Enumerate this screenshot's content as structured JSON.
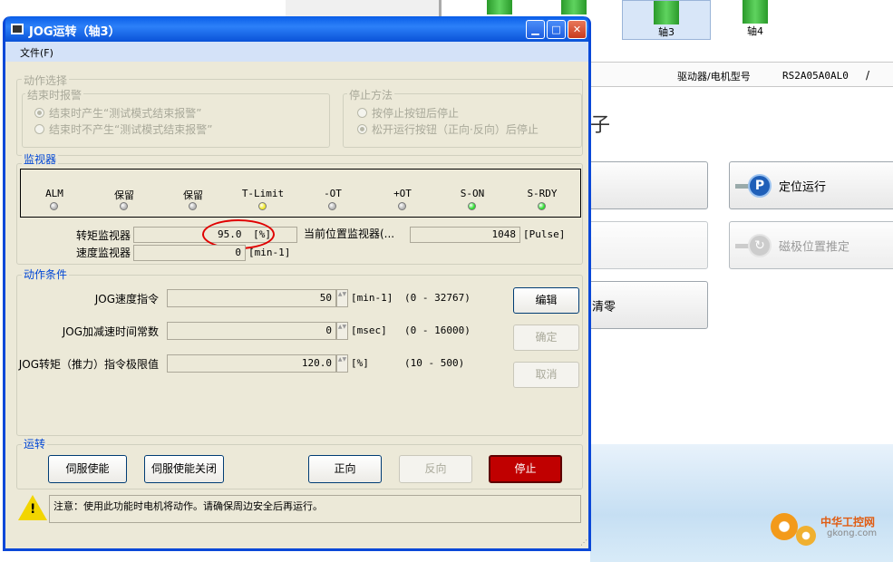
{
  "background": {
    "axes": [
      {
        "label": "轴3"
      },
      {
        "label": "轴4"
      }
    ],
    "header": {
      "driver_label": "驱动器/电机型号",
      "model": "RS2A05A0AL0",
      "slash": "/"
    },
    "buttons": {
      "positioning": "定位运行",
      "magnetic": "磁极位置推定",
      "clear": "清零"
    },
    "watermark": {
      "brand": "中华工控网",
      "url": "gkong.com"
    }
  },
  "dialog": {
    "title": "JOG运转（轴3）",
    "menu": {
      "file": "文件(F)"
    },
    "action_select": {
      "label": "动作选择",
      "end_alarm": {
        "label": "结束时报警",
        "opt1": "结束时产生“测试模式结束报警”",
        "opt2": "结束时不产生“测试模式结束报警”"
      },
      "stop_method": {
        "label": "停止方法",
        "opt1": "按停止按钮后停止",
        "opt2": "松开运行按钮（正向·反向）后停止"
      }
    },
    "monitor": {
      "label": "监视器",
      "leds": [
        {
          "label": "ALM",
          "color": "#b8b8b8"
        },
        {
          "label": "保留",
          "color": "#b8b8b8"
        },
        {
          "label": "保留",
          "color": "#b8b8b8"
        },
        {
          "label": "T-Limit",
          "color": "#f2ea2a"
        },
        {
          "label": "-OT",
          "color": "#b8b8b8"
        },
        {
          "label": "+OT",
          "color": "#b8b8b8"
        },
        {
          "label": "S-ON",
          "color": "#2ee02e"
        },
        {
          "label": "S-RDY",
          "color": "#2ee02e"
        }
      ],
      "torque_label": "转矩监视器",
      "torque_value": "95.0",
      "torque_unit": "[%]",
      "speed_label": "速度监视器",
      "speed_value": "0",
      "speed_unit": "[min-1]",
      "position_label": "当前位置监视器(...",
      "position_value": "1048",
      "position_unit": "[Pulse]"
    },
    "conditions": {
      "label": "动作条件",
      "rows": [
        {
          "label": "JOG速度指令",
          "value": "50",
          "unit": "[min-1]",
          "range": "(0 - 32767)"
        },
        {
          "label": "JOG加减速时间常数",
          "value": "0",
          "unit": "[msec]",
          "range": "(0 - 16000)"
        },
        {
          "label": "JOG转矩（推力）指令极限值",
          "value": "120.0",
          "unit": "[%]",
          "range": "(10 - 500)"
        }
      ],
      "edit": "编辑",
      "confirm": "确定",
      "cancel": "取消"
    },
    "operation": {
      "label": "运转",
      "servo_on": "伺服使能",
      "servo_off": "伺服使能关闭",
      "forward": "正向",
      "reverse": "反向",
      "stop": "停止"
    },
    "warning": "注意：使用此功能时电机将动作。请确保周边安全后再运行。"
  }
}
